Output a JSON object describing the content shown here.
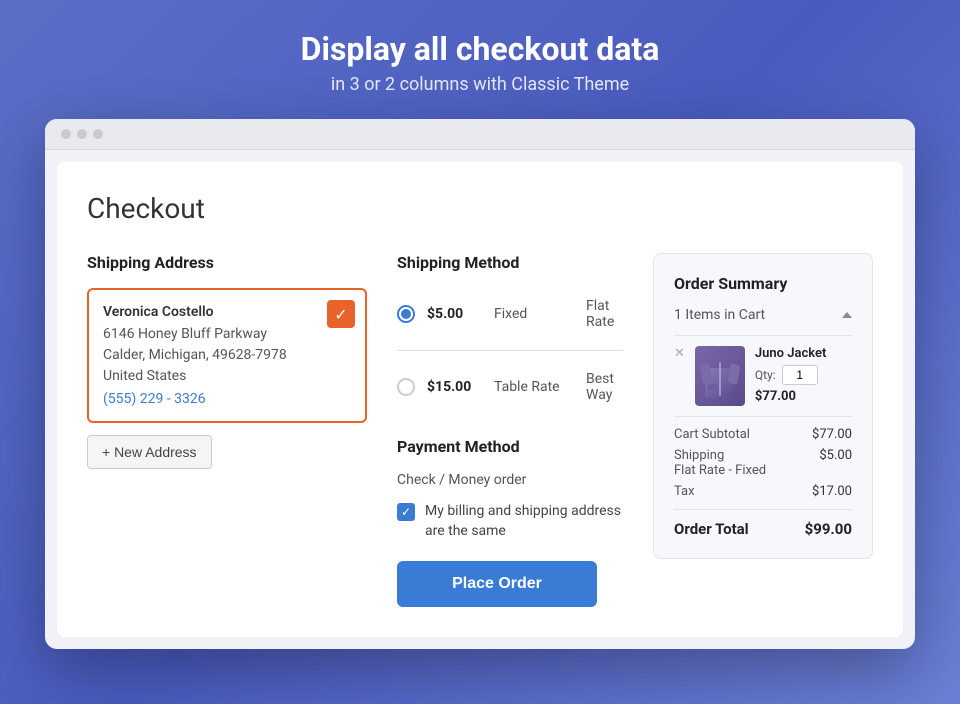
{
  "hero": {
    "title": "Display all checkout data",
    "subtitle": "in 3 or 2 columns with Classic Theme"
  },
  "browser": {
    "dots": [
      "gray",
      "gray",
      "gray"
    ]
  },
  "page": {
    "title": "Checkout"
  },
  "shipping_address": {
    "section_title": "Shipping Address",
    "address": {
      "name": "Veronica Costello",
      "street": "6146 Honey Bluff Parkway",
      "city_state_zip": "Calder, Michigan, 49628-7978",
      "country": "United States",
      "phone": "(555) 229 - 3326"
    },
    "new_address_btn": "+ New Address"
  },
  "shipping_method": {
    "section_title": "Shipping Method",
    "options": [
      {
        "price": "$5.00",
        "label": "Fixed",
        "name": "Flat Rate",
        "selected": true
      },
      {
        "price": "$15.00",
        "label": "Table Rate",
        "name": "Best Way",
        "selected": false
      }
    ]
  },
  "payment_method": {
    "section_title": "Payment Method",
    "method_label": "Check / Money order",
    "billing_same_label": "My billing and shipping address are the same",
    "place_order_btn": "Place Order"
  },
  "order_summary": {
    "title": "Order Summary",
    "items_count": "1 Items in Cart",
    "item": {
      "name": "Juno Jacket",
      "qty_label": "Qty:",
      "qty": "1",
      "price": "$77.00"
    },
    "rows": [
      {
        "label": "Cart Subtotal",
        "value": "$77.00"
      },
      {
        "label": "Shipping\nFlat Rate - Fixed",
        "value": "$5.00"
      },
      {
        "label": "Tax",
        "value": "$17.00"
      }
    ],
    "total_label": "Order Total",
    "total_value": "$99.00"
  }
}
